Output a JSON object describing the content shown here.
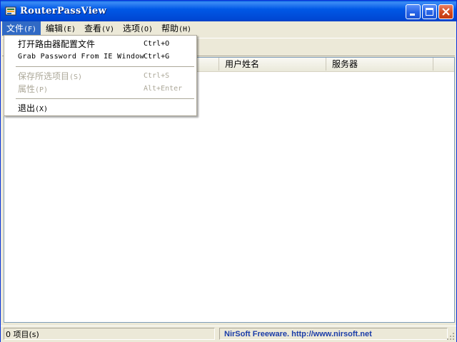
{
  "window": {
    "title": "RouterPassView"
  },
  "menubar": {
    "items": [
      {
        "label": "文件",
        "accel": "(F)"
      },
      {
        "label": "编辑",
        "accel": "(E)"
      },
      {
        "label": "查看",
        "accel": "(V)"
      },
      {
        "label": "选项",
        "accel": "(O)"
      },
      {
        "label": "帮助",
        "accel": "(H)"
      }
    ]
  },
  "file_menu": {
    "items": [
      {
        "label": "打开路由器配置文件",
        "shortcut": "Ctrl+O",
        "enabled": true
      },
      {
        "label": "Grab Password From IE Window",
        "shortcut": "Ctrl+G",
        "enabled": true
      },
      {
        "label": "保存所选项目",
        "accel": "(S)",
        "shortcut": "Ctrl+S",
        "enabled": false
      },
      {
        "label": "属性",
        "accel": "(P)",
        "shortcut": "Alt+Enter",
        "enabled": false
      },
      {
        "label": "退出",
        "accel": "(X)",
        "enabled": true
      }
    ]
  },
  "list": {
    "columns": [
      "用户姓名",
      "服务器"
    ]
  },
  "statusbar": {
    "item_count": "0 项目(s)",
    "credit": "NirSoft Freeware.  http://www.nirsoft.net"
  },
  "colors": {
    "titlebar": "#0054e3",
    "menu_highlight": "#316ac5",
    "credit_text": "#1a3ca8",
    "close_button": "#d2491e"
  },
  "icons": [
    "app-icon",
    "minimize-icon",
    "maximize-icon",
    "close-icon",
    "resize-grip-icon"
  ]
}
